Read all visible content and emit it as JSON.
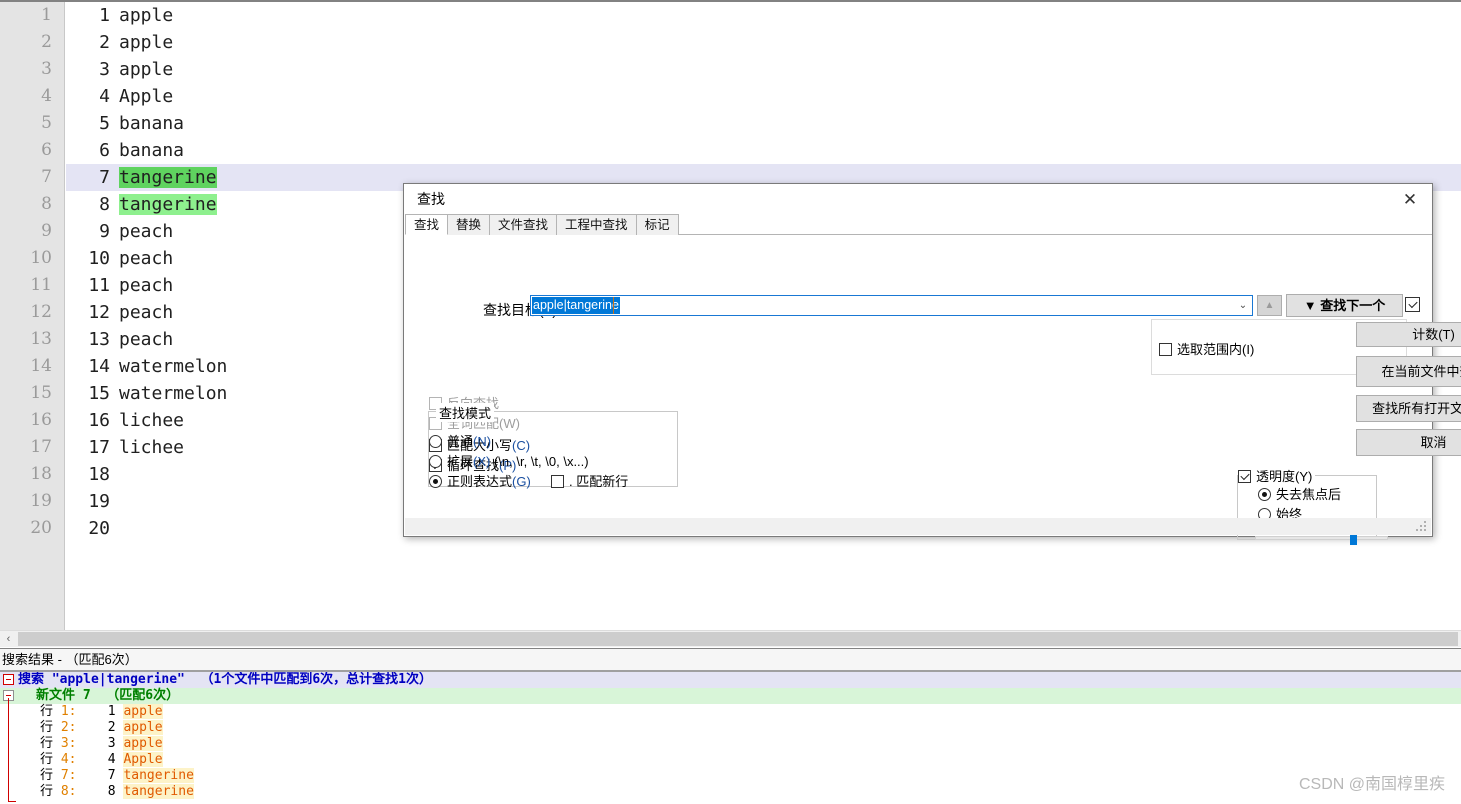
{
  "editor": {
    "lines": [
      {
        "n": "1",
        "text": "apple",
        "hl": "none"
      },
      {
        "n": "2",
        "text": "apple",
        "hl": "none"
      },
      {
        "n": "3",
        "text": "apple",
        "hl": "none"
      },
      {
        "n": "4",
        "text": "Apple",
        "hl": "none"
      },
      {
        "n": "5",
        "text": "banana",
        "hl": "none"
      },
      {
        "n": "6",
        "text": "banana",
        "hl": "none"
      },
      {
        "n": "7",
        "text": "tangerine",
        "hl": "current"
      },
      {
        "n": "8",
        "text": "tangerine",
        "hl": "mark"
      },
      {
        "n": "9",
        "text": "peach",
        "hl": "none"
      },
      {
        "n": "10",
        "text": "peach",
        "hl": "none"
      },
      {
        "n": "11",
        "text": "peach",
        "hl": "none"
      },
      {
        "n": "12",
        "text": "peach",
        "hl": "none"
      },
      {
        "n": "13",
        "text": "peach",
        "hl": "none"
      },
      {
        "n": "14",
        "text": "watermelon",
        "hl": "none"
      },
      {
        "n": "15",
        "text": "watermelon",
        "hl": "none"
      },
      {
        "n": "16",
        "text": "lichee",
        "hl": "none"
      },
      {
        "n": "17",
        "text": "lichee",
        "hl": "none"
      },
      {
        "n": "18",
        "text": "",
        "hl": "none"
      },
      {
        "n": "19",
        "text": "",
        "hl": "none"
      },
      {
        "n": "20",
        "text": "",
        "hl": "none"
      }
    ],
    "scroll_left_arrow": "‹"
  },
  "dialog": {
    "title": "查找",
    "close_icon": "✕",
    "tabs": [
      {
        "label": "查找",
        "active": true
      },
      {
        "label": "替换",
        "active": false
      },
      {
        "label": "文件查找",
        "active": false
      },
      {
        "label": "工程中查找",
        "active": false
      },
      {
        "label": "标记",
        "active": false
      }
    ],
    "find_label": "查找目标(F)：",
    "find_value": "apple|tangerine",
    "combo_arrow": "⌄",
    "up_button": "▲",
    "find_next": "▼ 查找下一个",
    "in_selection": "选取范围内(I)",
    "buttons": {
      "count": "计数(T)",
      "find_in_current": "在当前文件中查找",
      "find_all_open": "查找所有打开文件(O)",
      "cancel": "取消"
    },
    "options": [
      {
        "label": "反向查找",
        "checked": false,
        "disabled": true,
        "mnemonic": ""
      },
      {
        "label": "全词匹配",
        "checked": false,
        "disabled": true,
        "mnemonic": "(W)"
      },
      {
        "label": "匹配大小写",
        "checked": false,
        "disabled": false,
        "mnemonic": "(C)"
      },
      {
        "label": "循环查找",
        "checked": true,
        "disabled": false,
        "mnemonic": "(P)"
      }
    ],
    "search_mode": {
      "legend": "查找模式",
      "items": [
        {
          "label": "普通",
          "mnemonic": "(N)",
          "selected": false,
          "extra": ""
        },
        {
          "label": "扩展",
          "mnemonic": "(X)",
          "selected": false,
          "extra": " (\\n, \\r, \\t, \\0, \\x...)"
        },
        {
          "label": "正则表达式",
          "mnemonic": "(G)",
          "selected": true,
          "extra": ""
        }
      ],
      "match_newline": ". 匹配新行",
      "match_newline_checked": false
    },
    "transparency": {
      "label": "透明度(Y)",
      "checked": true,
      "options": [
        {
          "label": "失去焦点后",
          "selected": true
        },
        {
          "label": "始终",
          "selected": false
        }
      ],
      "slider_percent": 75
    }
  },
  "results": {
    "panel_title": "搜索结果 - （匹配6次）",
    "header": "搜索 \"apple|tangerine\"  （1个文件中匹配到6次，总计查找1次）",
    "file": "新文件 7  （匹配6次）",
    "row_label": "行",
    "rows": [
      {
        "row": "1:",
        "num": "1",
        "text": "apple"
      },
      {
        "row": "2:",
        "num": "2",
        "text": "apple"
      },
      {
        "row": "3:",
        "num": "3",
        "text": "apple"
      },
      {
        "row": "4:",
        "num": "4",
        "text": "Apple"
      },
      {
        "row": "7:",
        "num": "7",
        "text": "tangerine"
      },
      {
        "row": "8:",
        "num": "8",
        "text": "tangerine"
      }
    ]
  },
  "watermark": "CSDN @南国椁里疾",
  "colors": {
    "accent": "#0078d7",
    "current_match": "#5fd35f",
    "mark": "#8ef08e",
    "current_line": "#e4e4f4",
    "result_hit": "#e05a00",
    "result_file": "#008000",
    "result_header": "#0000c0"
  }
}
